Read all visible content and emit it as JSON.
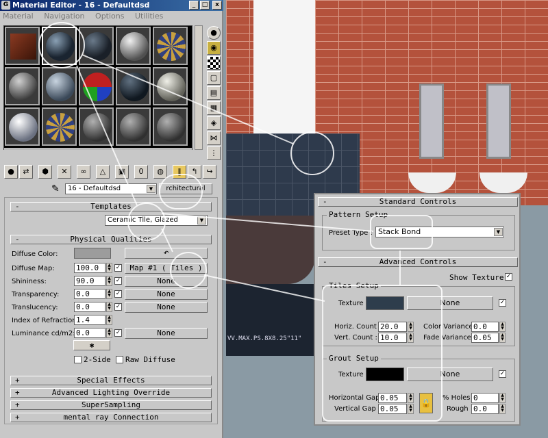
{
  "window": {
    "title": "Material Editor - 16 - Defaultdsd",
    "min": "_",
    "max": "□",
    "close": "x"
  },
  "menu": [
    "Material",
    "Navigation",
    "Options",
    "Utilities"
  ],
  "material_name": "16 - Defaultdsd",
  "material_type": "rchitectural",
  "rollouts": {
    "templates": {
      "sign": "-",
      "title": "Templates",
      "value": "Ceramic Tile, Glazed"
    },
    "physical": {
      "sign": "-",
      "title": "Physical Qualities",
      "diffuse_color": "Diffuse Color:",
      "rows": [
        {
          "label": "Diffuse Map:",
          "value": "100.0",
          "check": "✓",
          "map": "Map #1  ( Tiles )"
        },
        {
          "label": "Shininess:",
          "value": "90.0",
          "check": "✓",
          "map": "None"
        },
        {
          "label": "Transparency:",
          "value": "0.0",
          "check": "✓",
          "map": "None"
        },
        {
          "label": "Translucency:",
          "value": "0.0",
          "check": "✓",
          "map": "None"
        },
        {
          "label": "Index of Refraction:",
          "value": "1.4"
        },
        {
          "label": "Luminance cd/m2:",
          "value": "0.0",
          "check": "✓",
          "map": "None"
        }
      ],
      "two_side": "2-Side",
      "raw_diffuse": "Raw Diffuse"
    },
    "collapsed": [
      {
        "sign": "+",
        "title": "Special Effects"
      },
      {
        "sign": "+",
        "title": "Advanced Lighting Override"
      },
      {
        "sign": "+",
        "title": "SuperSampling"
      },
      {
        "sign": "+",
        "title": "mental ray Connection"
      }
    ]
  },
  "zoom": {
    "standard": {
      "sign": "-",
      "title": "Standard Controls"
    },
    "pattern_setup": "Pattern Setup",
    "preset_label": "Preset Type :",
    "preset_value": "Stack Bond",
    "advanced": {
      "sign": "-",
      "title": "Advanced Controls"
    },
    "show_texture": "Show Texture",
    "show_texture_check": "✓",
    "tiles": {
      "title": "Tiles Setup",
      "texture": "Texture :",
      "none": "None",
      "check": "✓",
      "horiz_label": "Horiz. Count :",
      "horiz": "20.0",
      "vert_label": "Vert. Count :",
      "vert": "10.0",
      "cv_label": "Color Variance :",
      "cv": "0.0",
      "fv_label": "Fade Variance :",
      "fv": "0.05"
    },
    "grout": {
      "title": "Grout Setup",
      "texture": "Texture :",
      "none": "None",
      "check": "✓",
      "hgap_label": "Horizontal Gap :",
      "hgap": "0.05",
      "vgap_label": "Vertical Gap :",
      "vgap": "0.05",
      "holes_label": "% Holes :",
      "holes": "0",
      "rough_label": "Rough :",
      "rough": "0.0"
    }
  },
  "scene_caption": "VV.MAX.PS.8X8.25\"11\"",
  "colors": {
    "tile_texture": "#2e3d4c",
    "grout_texture": "#000000",
    "diffuse_swatch": "#9c9c9c"
  }
}
